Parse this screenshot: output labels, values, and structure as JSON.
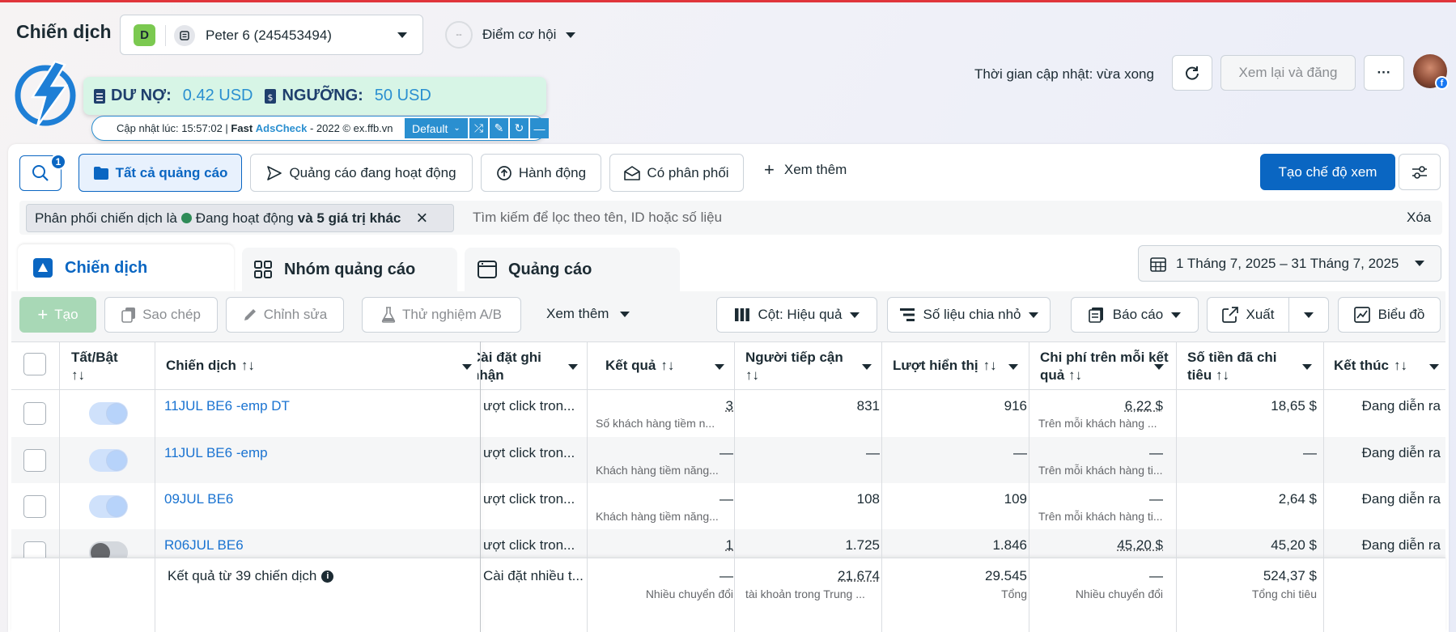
{
  "header": {
    "title": "Chiến dịch",
    "account_badge": "D",
    "account_name": "Peter 6 (245453494)",
    "opportunity_score": "--",
    "opportunity_label": "Điểm cơ hội",
    "update_time": "Thời gian cập nhật: vừa xong",
    "review_publish": "Xem lại và đăng",
    "more": "···"
  },
  "extension": {
    "debt_label": "DƯ NỢ:",
    "debt_value": "0.42 USD",
    "threshold_label": "NGƯỠNG:",
    "threshold_value": "50 USD",
    "updated_prefix": "Cập nhật lúc: 15:57:02 | ",
    "brand_fast": "Fast ",
    "brand_ads": "AdsCheck",
    "brand_suffix": " - 2022 © ex.ffb.vn",
    "preset": "Default"
  },
  "filters": {
    "search_badge": "1",
    "all_ads": "Tất cả quảng cáo",
    "active_ads": "Quảng cáo đang hoạt động",
    "actions": "Hành động",
    "delivered": "Có phân phối",
    "see_more": "Xem thêm",
    "create_view": "Tạo chế độ xem",
    "chip_prefix": "Phân phối chiến dịch là",
    "chip_value": "Đang hoạt động",
    "chip_more": "và 5 giá trị khác",
    "search_placeholder": "Tìm kiếm để lọc theo tên, ID hoặc số liệu",
    "clear": "Xóa"
  },
  "tabs": {
    "campaigns": "Chiến dịch",
    "ad_sets": "Nhóm quảng cáo",
    "ads": "Quảng cáo",
    "date_range": "1 Tháng 7, 2025 – 31 Tháng 7, 2025"
  },
  "toolbar": {
    "create": "Tạo",
    "duplicate": "Sao chép",
    "edit": "Chỉnh sửa",
    "ab_test": "Thử nghiệm A/B",
    "see_more": "Xem thêm",
    "columns": "Cột: Hiệu quả",
    "breakdown": "Số liệu chia nhỏ",
    "reports": "Báo cáo",
    "export": "Xuất",
    "charts": "Biểu đồ"
  },
  "table": {
    "headers": {
      "toggle": "Tất/Bật",
      "campaign": "Chiến dịch",
      "attribution": "Cài đặt ghi nhận",
      "results": "Kết quả",
      "reach": "Người tiếp cận",
      "impressions": "Lượt hiển thị",
      "cost_per_result": "Chi phí trên mỗi kết quả",
      "amount_spent": "Số tiền đã chi tiêu",
      "ends": "Kết thúc"
    },
    "rows": [
      {
        "name": "11JUL BE6 -emp DT",
        "attribution": "ượt click tron...",
        "result": "3",
        "result_sub": "Số khách hàng tiềm n...",
        "reach": "831",
        "impressions": "916",
        "cpr": "6,22 $",
        "cpr_sub": "Trên mỗi khách hàng ...",
        "spent": "18,65 $",
        "ends": "Đang diễn ra"
      },
      {
        "name": "11JUL BE6 -emp",
        "attribution": "ượt click tron...",
        "result": "—",
        "result_sub": "Khách hàng tiềm năng...",
        "reach": "—",
        "impressions": "—",
        "cpr": "—",
        "cpr_sub": "Trên mỗi khách hàng ti...",
        "spent": "—",
        "ends": "Đang diễn ra"
      },
      {
        "name": "09JUL BE6",
        "attribution": "ượt click tron...",
        "result": "—",
        "result_sub": "Khách hàng tiềm năng...",
        "reach": "108",
        "impressions": "109",
        "cpr": "—",
        "cpr_sub": "Trên mỗi khách hàng ti...",
        "spent": "2,64 $",
        "ends": "Đang diễn ra"
      },
      {
        "name": "R06JUL BE6",
        "attribution": "ượt click tron...",
        "result": "1",
        "result_sub": "",
        "reach": "1.725",
        "impressions": "1.846",
        "cpr": "45,20 $",
        "cpr_sub": "",
        "spent": "45,20 $",
        "ends": "Đang diễn ra"
      }
    ],
    "summary": {
      "label": "Kết quả từ 39 chiến dịch",
      "attribution": "Cài đặt nhiều t...",
      "result": "—",
      "result_sub": "Nhiều chuyển đổi",
      "reach": "21.674",
      "reach_sub": "tài khoản trong Trung ...",
      "impressions": "29.545",
      "impressions_sub": "Tổng",
      "cpr": "—",
      "cpr_sub": "Nhiều chuyển đổi",
      "spent": "524,37 $",
      "spent_sub": "Tổng chi tiêu"
    }
  },
  "colors": {
    "primary": "#0a66c2",
    "link": "#1a73d1",
    "extension_bg": "#d7f5e6",
    "extension_blue": "#2a8fd0",
    "active_dot": "#2e8b57",
    "topline": "#e0353b"
  }
}
